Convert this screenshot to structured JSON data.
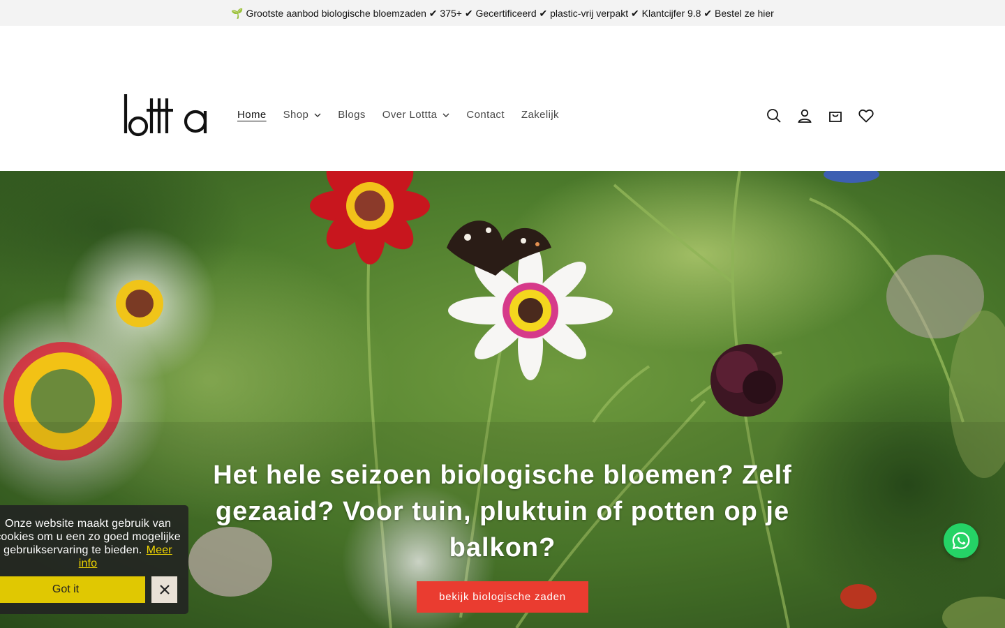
{
  "announcement": {
    "text": "🌱 Grootste aanbod biologische bloemzaden ✔ 375+ ✔ Gecertificeerd ✔ plastic-vrij verpakt ✔ Klantcijfer 9.8 ✔ Bestel ze hier"
  },
  "header": {
    "logo_text": "lottta",
    "nav": [
      {
        "label": "Home",
        "active": true,
        "dropdown": false
      },
      {
        "label": "Shop",
        "active": false,
        "dropdown": true
      },
      {
        "label": "Blogs",
        "active": false,
        "dropdown": false
      },
      {
        "label": "Over Lottta",
        "active": false,
        "dropdown": true
      },
      {
        "label": "Contact",
        "active": false,
        "dropdown": false
      },
      {
        "label": "Zakelijk",
        "active": false,
        "dropdown": false
      }
    ],
    "icons": [
      "search-icon",
      "account-icon",
      "cart-icon",
      "wishlist-heart-icon"
    ]
  },
  "hero": {
    "heading": "Het hele seizoen biologische bloemen? Zelf gezaaid? Voor tuin, pluktuin of potten op je balkon?",
    "button_label": "bekijk biologische zaden",
    "button_color": "#ea3c30"
  },
  "cookie_banner": {
    "text": "Onze website maakt gebruik van cookies om u een zo goed mogelijke gebruikservaring te bieden.",
    "more_label": "Meer info",
    "accept_label": "Got it",
    "accent_color": "#f1d600"
  },
  "whatsapp": {
    "icon": "whatsapp-icon",
    "color": "#25d366"
  }
}
